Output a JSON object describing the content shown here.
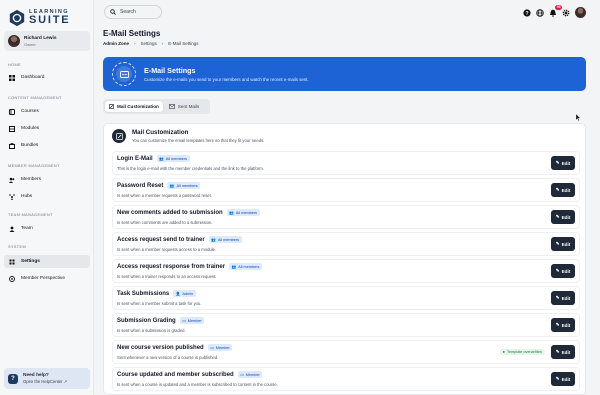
{
  "brand": {
    "line1": "LEARNING",
    "line2": "SUITE"
  },
  "user": {
    "name": "Richard Lewis",
    "role": "Owner"
  },
  "sidebar": {
    "sections": [
      {
        "title": "HOME",
        "items": [
          {
            "label": "Dashboard",
            "icon": "dashboard-icon"
          }
        ]
      },
      {
        "title": "CONTENT MANAGEMENT",
        "items": [
          {
            "label": "Courses",
            "icon": "courses-icon"
          },
          {
            "label": "Modules",
            "icon": "modules-icon"
          },
          {
            "label": "Bundles",
            "icon": "bundles-icon"
          }
        ]
      },
      {
        "title": "MEMBER MANAGEMENT",
        "items": [
          {
            "label": "Members",
            "icon": "members-icon"
          },
          {
            "label": "Hubs",
            "icon": "hubs-icon"
          }
        ]
      },
      {
        "title": "TEAM MANAGEMENT",
        "items": [
          {
            "label": "Team",
            "icon": "team-icon"
          }
        ]
      },
      {
        "title": "SYSTEM",
        "items": [
          {
            "label": "Settings",
            "icon": "settings-icon",
            "active": true
          },
          {
            "label": "Member Perspective",
            "icon": "perspective-icon"
          }
        ]
      }
    ],
    "help": {
      "title": "Need help?",
      "link": "Open the HelpCenter"
    }
  },
  "topbar": {
    "search_placeholder": "Search",
    "notifications_count": "99"
  },
  "page": {
    "title": "E-Mail Settings",
    "breadcrumb": [
      "Admin Zone",
      "Settings",
      "E-Mail Settings"
    ]
  },
  "banner": {
    "title": "E-Mail Settings",
    "subtitle": "Customize the e-mails you send to your members and watch the recent e-mails sent."
  },
  "tabs": [
    {
      "label": "Mail Customization",
      "active": true
    },
    {
      "label": "Sent Mails",
      "active": false
    }
  ],
  "card": {
    "title": "Mail Customization",
    "subtitle": "You can customize the email templates here so that they fit your needs.",
    "edit_label": "Edit",
    "rows": [
      {
        "name": "Login E-Mail",
        "tag": "All members",
        "desc": "This is the login e-mail with the member credentials and the link to the platform."
      },
      {
        "name": "Password Reset",
        "tag": "All members",
        "desc": "Is sent when a member requests a password reset."
      },
      {
        "name": "New comments added to submission",
        "tag": "All members",
        "desc": "Is sent when comments are added to a submission."
      },
      {
        "name": "Access request send to trainer",
        "tag": "All members",
        "desc": "Is sent when a member requests access to a module."
      },
      {
        "name": "Access request response from trainer",
        "tag": "All members",
        "desc": "Is sent when a trainer responds to an access request."
      },
      {
        "name": "Task Submissions",
        "tag": "Admin",
        "desc": "Is sent when a member submit a task for you."
      },
      {
        "name": "Submission Grading",
        "tag": "Member",
        "desc": "Is sent when a submission is graded."
      },
      {
        "name": "New course version published",
        "tag": "Member",
        "desc": "Sent whenever a new version of a course is published.",
        "status": "Template overwritten"
      },
      {
        "name": "Course updated and member subscribed",
        "tag": "Member",
        "desc": "Is sent when a course is updated and a member is subscribed to content in the course."
      }
    ]
  }
}
